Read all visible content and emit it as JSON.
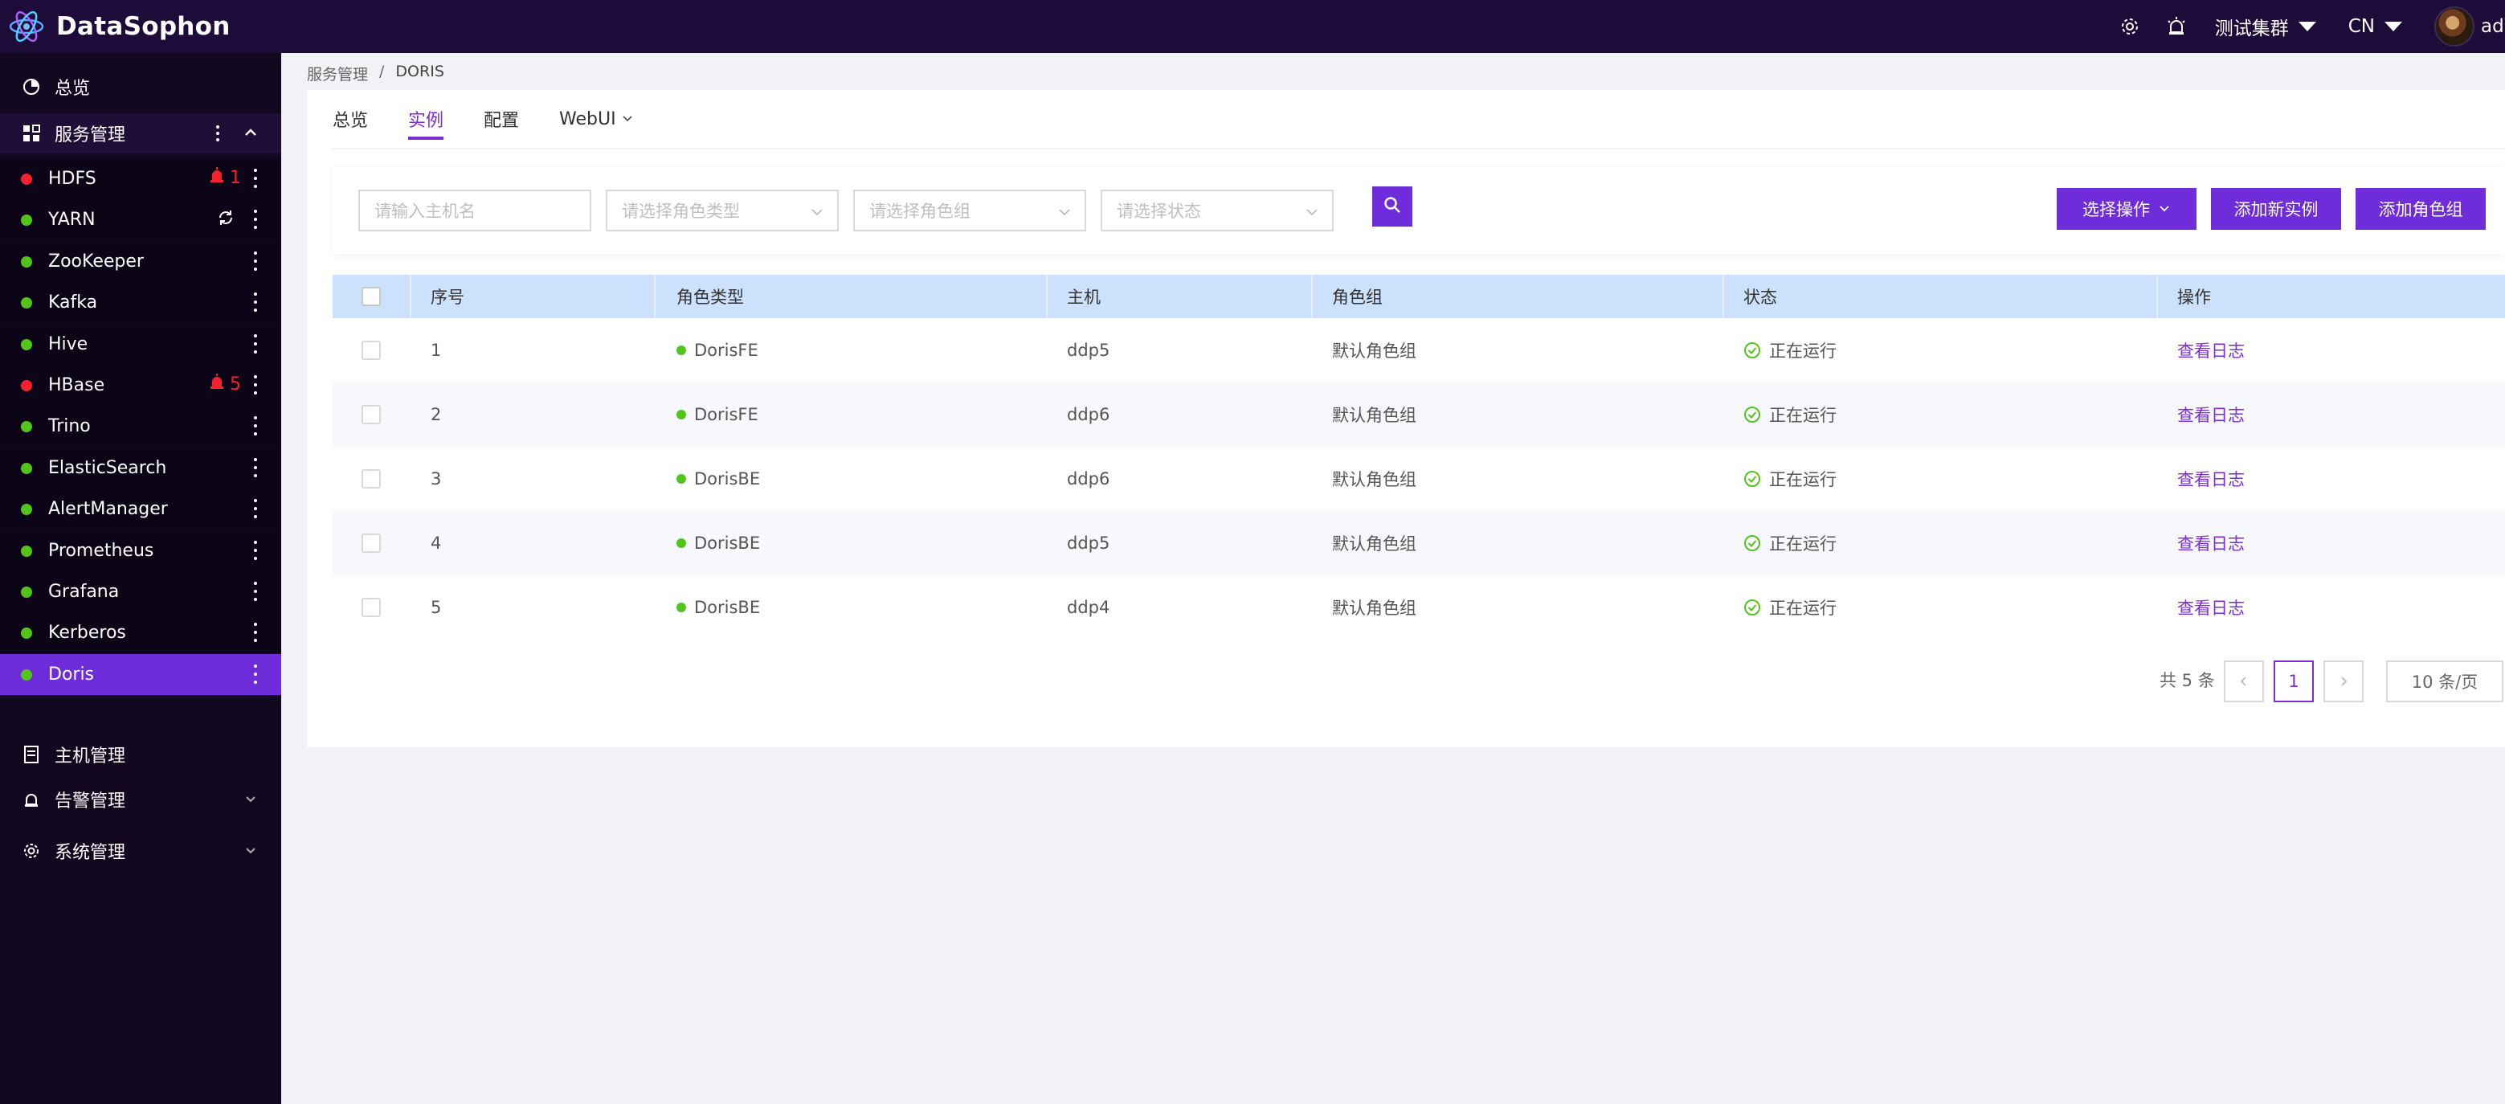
{
  "app": {
    "title": "DataSophon"
  },
  "header": {
    "cluster": "测试集群",
    "language": "CN",
    "user": "admin"
  },
  "sidebar": {
    "overview": "总览",
    "service_mgmt": "服务管理",
    "services": [
      {
        "name": "HDFS",
        "status": "red",
        "alarm": "1"
      },
      {
        "name": "YARN",
        "status": "green",
        "sync": true
      },
      {
        "name": "ZooKeeper",
        "status": "green"
      },
      {
        "name": "Kafka",
        "status": "green"
      },
      {
        "name": "Hive",
        "status": "green"
      },
      {
        "name": "HBase",
        "status": "red",
        "alarm": "5"
      },
      {
        "name": "Trino",
        "status": "green"
      },
      {
        "name": "ElasticSearch",
        "status": "green"
      },
      {
        "name": "AlertManager",
        "status": "green"
      },
      {
        "name": "Prometheus",
        "status": "green"
      },
      {
        "name": "Grafana",
        "status": "green"
      },
      {
        "name": "Kerberos",
        "status": "green"
      },
      {
        "name": "Doris",
        "status": "green",
        "active": true
      }
    ],
    "host_mgmt": "主机管理",
    "alert_mgmt": "告警管理",
    "system_mgmt": "系统管理"
  },
  "breadcrumb": {
    "parent": "服务管理",
    "separator": "/",
    "current": "DORIS"
  },
  "tabs": [
    "总览",
    "实例",
    "配置",
    "WebUI"
  ],
  "active_tab": "实例",
  "filters": {
    "host_placeholder": "请输入主机名",
    "role_type_placeholder": "请选择角色类型",
    "role_group_placeholder": "请选择角色组",
    "status_placeholder": "请选择状态"
  },
  "actions": {
    "select_op": "选择操作",
    "add_instance": "添加新实例",
    "add_role_group": "添加角色组"
  },
  "table": {
    "columns": [
      "序号",
      "角色类型",
      "主机",
      "角色组",
      "状态",
      "操作"
    ],
    "rows": [
      {
        "no": "1",
        "role": "DorisFE",
        "host": "ddp5",
        "group": "默认角色组",
        "status": "正在运行",
        "op": "查看日志"
      },
      {
        "no": "2",
        "role": "DorisFE",
        "host": "ddp6",
        "group": "默认角色组",
        "status": "正在运行",
        "op": "查看日志"
      },
      {
        "no": "3",
        "role": "DorisBE",
        "host": "ddp6",
        "group": "默认角色组",
        "status": "正在运行",
        "op": "查看日志"
      },
      {
        "no": "4",
        "role": "DorisBE",
        "host": "ddp5",
        "group": "默认角色组",
        "status": "正在运行",
        "op": "查看日志"
      },
      {
        "no": "5",
        "role": "DorisBE",
        "host": "ddp4",
        "group": "默认角色组",
        "status": "正在运行",
        "op": "查看日志"
      }
    ]
  },
  "pagination": {
    "total": "共 5 条",
    "current_page": "1",
    "page_size": "10 条/页"
  },
  "colors": {
    "accent": "#6f2cdb",
    "header_bg": "#1d0c3a",
    "sidebar_bg": "#12081f",
    "table_head": "#cce1fb",
    "ok": "#52c41a",
    "error": "#f5222d"
  }
}
